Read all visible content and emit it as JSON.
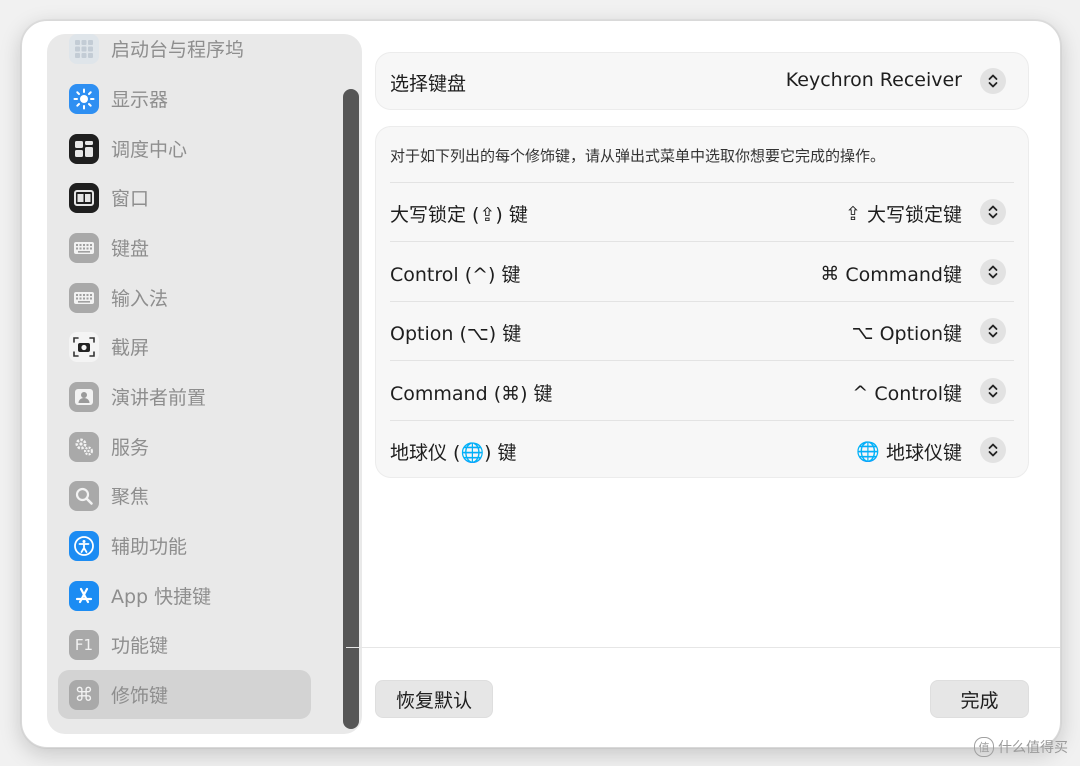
{
  "sidebar": {
    "items": [
      {
        "label": "启动台与程序坞",
        "icon": "launchpad-icon"
      },
      {
        "label": "显示器",
        "icon": "display-brightness-icon"
      },
      {
        "label": "调度中心",
        "icon": "mission-control-icon"
      },
      {
        "label": "窗口",
        "icon": "window-icon"
      },
      {
        "label": "键盘",
        "icon": "keyboard-icon"
      },
      {
        "label": "输入法",
        "icon": "input-method-icon"
      },
      {
        "label": "截屏",
        "icon": "screenshot-icon"
      },
      {
        "label": "演讲者前置",
        "icon": "presenter-overlay-icon"
      },
      {
        "label": "服务",
        "icon": "services-gear-icon"
      },
      {
        "label": "聚焦",
        "icon": "spotlight-search-icon"
      },
      {
        "label": "辅助功能",
        "icon": "accessibility-icon"
      },
      {
        "label": "App 快捷键",
        "icon": "app-store-icon"
      },
      {
        "label": "功能键",
        "icon": "function-key-icon"
      },
      {
        "label": "修饰键",
        "icon": "command-key-icon"
      }
    ],
    "selected_index": 13
  },
  "keyboard_select": {
    "label": "选择键盘",
    "value": "Keychron Receiver"
  },
  "modifier_card": {
    "description": "对于如下列出的每个修饰键，请从弹出式菜单中选取你想要它完成的操作。",
    "rows": [
      {
        "label": "大写锁定 (⇪) 键",
        "value_symbol": "⇪",
        "value_text": "大写锁定键"
      },
      {
        "label": "Control (^) 键",
        "value_symbol": "⌘",
        "value_text": "Command键"
      },
      {
        "label": "Option (⌥) 键",
        "value_symbol": "⌥",
        "value_text": "Option键"
      },
      {
        "label": "Command (⌘) 键",
        "value_symbol": "^",
        "value_text": "Control键"
      },
      {
        "label": "地球仪 (🌐) 键",
        "value_symbol": "🌐",
        "value_text": "地球仪键"
      }
    ]
  },
  "footer": {
    "restore_defaults": "恢复默认",
    "done": "完成"
  },
  "watermark": {
    "symbol": "值",
    "text": "什么值得买"
  },
  "colors": {
    "accent_blue": "#1c8cf3",
    "selected_row": "#d3d3d3"
  }
}
